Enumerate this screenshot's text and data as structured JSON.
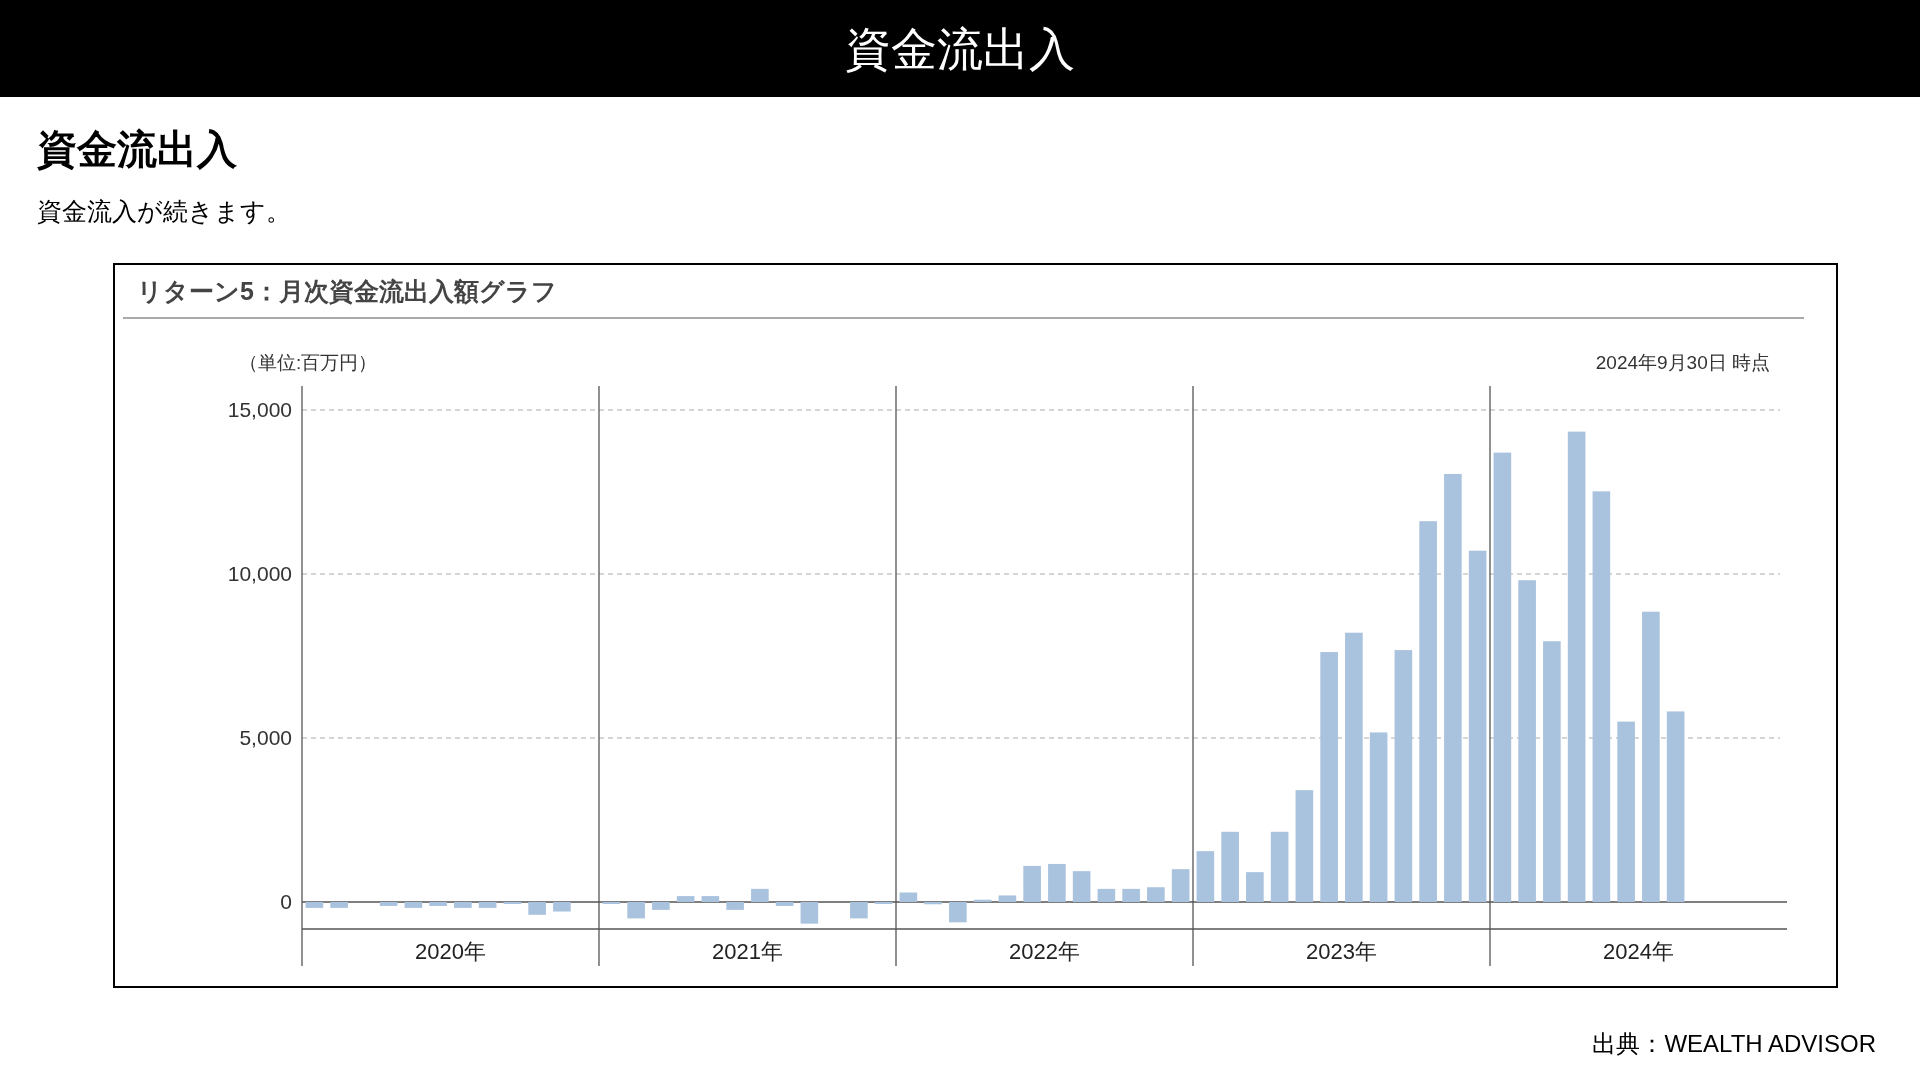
{
  "header": {
    "title": "資金流出入"
  },
  "section": {
    "heading": "資金流出入",
    "text": "資金流入が続きます。"
  },
  "chart_panel": {
    "title": "リターン5：月次資金流出入額グラフ",
    "unit": "（単位:百万円）",
    "as_of": "2024年9月30日 時点",
    "year_labels": [
      "2020年",
      "2021年",
      "2022年",
      "2023年",
      "2024年"
    ],
    "chart_data": {
      "type": "bar",
      "grid": true,
      "ylim": [
        -1950,
        15000
      ],
      "yticks": [
        {
          "value": 0,
          "label": "0"
        },
        {
          "value": 5000,
          "label": "5,000"
        },
        {
          "value": 10000,
          "label": "10,000"
        },
        {
          "value": 15000,
          "label": "15,000"
        }
      ],
      "values": [
        -180,
        -180,
        null,
        -120,
        -180,
        -120,
        -180,
        -180,
        -60,
        -390,
        -290,
        null,
        -60,
        -500,
        -240,
        180,
        180,
        -240,
        400,
        -120,
        -660,
        null,
        -500,
        -60,
        290,
        -70,
        -620,
        70,
        200,
        1100,
        1160,
        940,
        400,
        400,
        450,
        1000,
        1550,
        2140,
        910,
        2140,
        3410,
        7620,
        8210,
        5170,
        7680,
        11610,
        13050,
        10710,
        13700,
        9810,
        7950,
        14340,
        12520,
        5500,
        8850,
        5810,
        null,
        null,
        null,
        null
      ]
    }
  },
  "source": "出典：WEALTH ADVISOR"
}
